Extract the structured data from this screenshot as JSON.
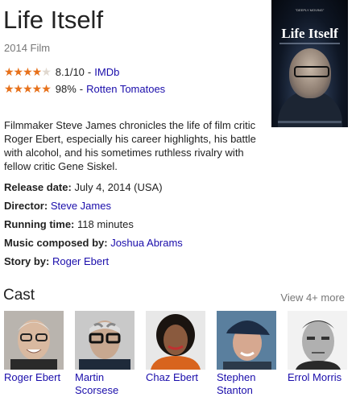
{
  "movie": {
    "title": "Life Itself",
    "subtitle": "2014 Film"
  },
  "ratings": [
    {
      "stars_filled": 4,
      "stars_total": 5,
      "score": "8.1/10",
      "source": "IMDb"
    },
    {
      "stars_filled": 5,
      "stars_total": 5,
      "score": "98%",
      "source": "Rotten Tomatoes"
    }
  ],
  "poster": {
    "tagline": "\"DEEPLY MOVING\" ",
    "title": "Life Itself"
  },
  "description": "Filmmaker Steve James chronicles the life of film critic Roger Ebert, especially his career highlights, his battle with alcohol, and his sometimes ruthless rivalry with fellow critic Gene Siskel.",
  "facts": [
    {
      "label": "Release date:",
      "value": "July 4, 2014 (USA)",
      "linked": false
    },
    {
      "label": "Director:",
      "value": "Steve James",
      "linked": true
    },
    {
      "label": "Running time:",
      "value": "118 minutes",
      "linked": false
    },
    {
      "label": "Music composed by:",
      "value": "Joshua Abrams",
      "linked": true
    },
    {
      "label": "Story by:",
      "value": "Roger Ebert",
      "linked": true
    }
  ],
  "cast": {
    "heading": "Cast",
    "view_more": "View 4+ more",
    "members": [
      {
        "name": "Roger Ebert"
      },
      {
        "name": "Martin Scorsese"
      },
      {
        "name": "Chaz Ebert"
      },
      {
        "name": "Stephen Stanton"
      },
      {
        "name": "Errol Morris"
      }
    ]
  },
  "colors": {
    "link": "#1a0dab",
    "star": "#e7711b",
    "muted": "#777777",
    "text": "#222222"
  }
}
